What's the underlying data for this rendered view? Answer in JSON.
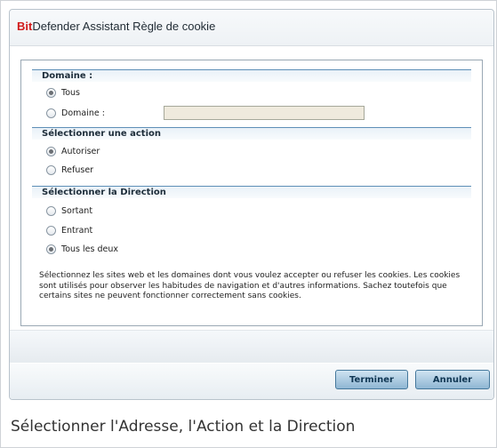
{
  "dialog": {
    "title_brand": "Bit",
    "title_rest": "Defender Assistant Règle de cookie"
  },
  "sections": {
    "domain": {
      "header": "Domaine :",
      "option_all": "Tous",
      "option_domain": "Domaine :",
      "domain_value": ""
    },
    "action": {
      "header": "Sélectionner une action",
      "option_allow": "Autoriser",
      "option_deny": "Refuser"
    },
    "direction": {
      "header": "Sélectionner la Direction",
      "option_out": "Sortant",
      "option_in": "Entrant",
      "option_both": "Tous les deux"
    }
  },
  "description": "Sélectionnez les sites web et les domaines dont vous voulez accepter ou refuser les cookies. Les cookies sont utilisés pour observer les habitudes de navigation et d'autres informations. Sachez toutefois que certains sites ne peuvent fonctionner correctement sans cookies.",
  "buttons": {
    "finish": "Terminer",
    "cancel": "Annuler"
  },
  "caption": "Sélectionner l'Adresse, l'Action et la Direction",
  "selected": {
    "domain": "Tous",
    "action": "Autoriser",
    "direction": "Tous les deux"
  }
}
